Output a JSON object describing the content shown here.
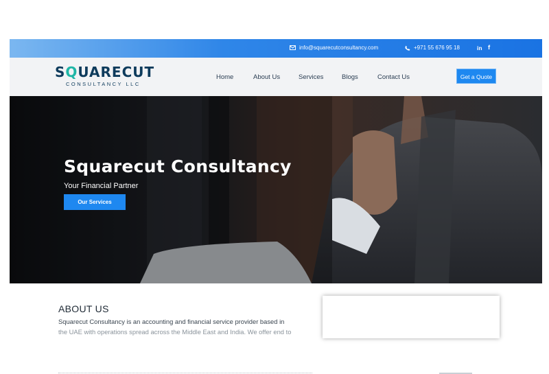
{
  "topbar": {
    "email": "info@squarecutconsultancy.com",
    "phone": "+971 55 676 95 18",
    "icons": [
      "mail-icon",
      "phone-icon",
      "linkedin-icon",
      "facebook-icon"
    ]
  },
  "logo": {
    "first_letter": "S",
    "q_letter": "Q",
    "rest": "UARECUT",
    "subtitle": "CONSULTANCY LLC"
  },
  "nav": {
    "items": [
      "Home",
      "About Us",
      "Services",
      "Blogs",
      "Contact Us"
    ],
    "cta": "Get a Quote"
  },
  "hero": {
    "title": "Squarecut Consultancy",
    "subtitle": "Your Financial Partner",
    "button": "Our Services"
  },
  "about": {
    "title": "ABOUT US",
    "line1": "Squarecut Consultancy is an accounting and financial service provider based in",
    "line2": "the UAE with operations spread across the Middle East and India. We offer end to"
  },
  "colors": {
    "accent": "#1e88f0",
    "brand_navy": "#0e3b5c",
    "brand_teal": "#1fb6a6"
  }
}
